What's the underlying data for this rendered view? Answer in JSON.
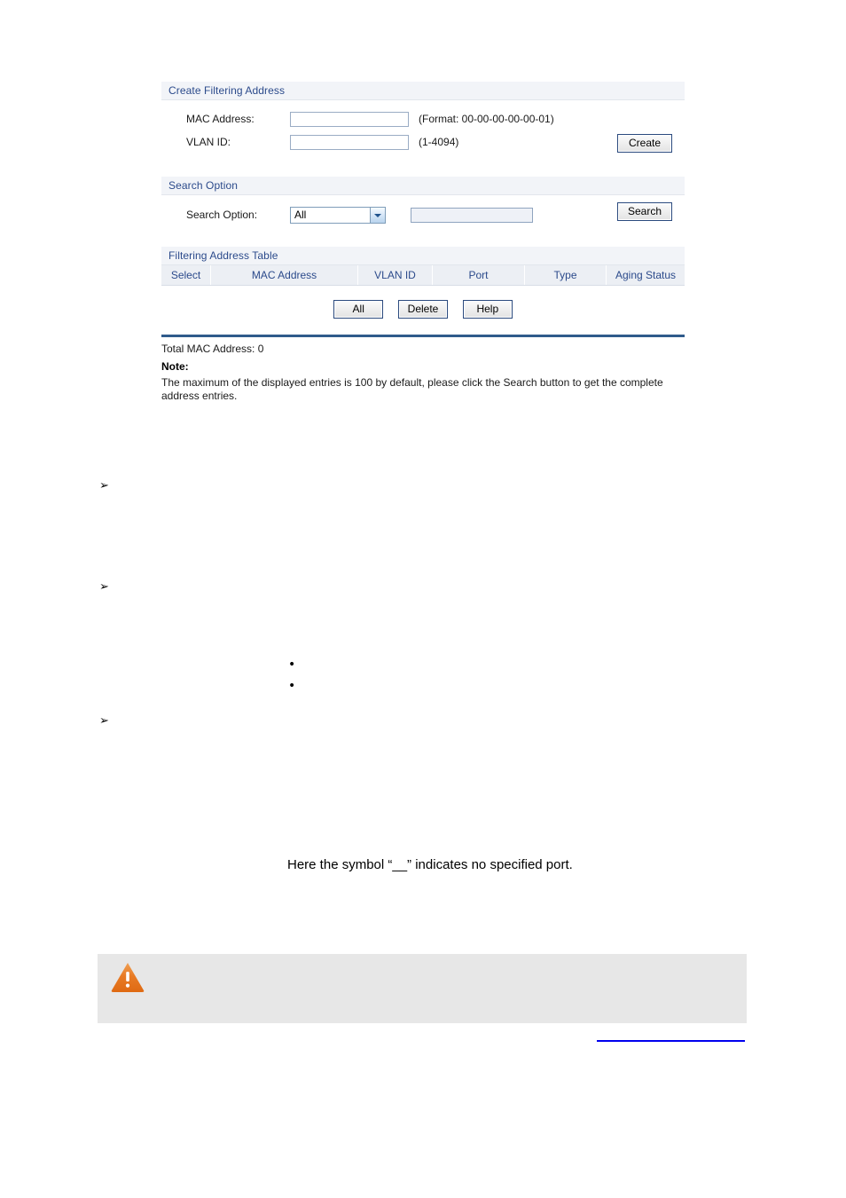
{
  "ui": {
    "create_section": {
      "title": "Create Filtering Address",
      "mac_label": "MAC Address:",
      "mac_value": "",
      "mac_hint": "(Format: 00-00-00-00-00-01)",
      "vlan_label": "VLAN ID:",
      "vlan_value": "",
      "vlan_hint": "(1-4094)",
      "create_button": "Create"
    },
    "search_section": {
      "title": "Search Option",
      "label": "Search Option:",
      "selected_option": "All",
      "options": [
        "All"
      ],
      "keyword_value": "",
      "search_button": "Search"
    },
    "table_section": {
      "title": "Filtering Address Table",
      "columns": [
        "Select",
        "MAC Address",
        "VLAN ID",
        "Port",
        "Type",
        "Aging Status"
      ],
      "rows": [],
      "buttons": [
        "All",
        "Delete",
        "Help"
      ]
    },
    "footer": {
      "total": "Total MAC Address: 0",
      "note_title": "Note:",
      "note_body": "The maximum of the displayed entries is 100 by default, please click the Search button to get the complete address entries."
    }
  },
  "document": {
    "arrow_marker": "➢",
    "bullet_marker": "•",
    "arrow_items": [
      "",
      "",
      ""
    ],
    "bullet_items": [
      "",
      ""
    ],
    "sentence": "Here the symbol “__” indicates no specified port.",
    "callout_text": "",
    "bottom_link_text": ""
  },
  "colors": {
    "accent_blue": "#2b4a8b",
    "rule_blue": "#2f5b8b",
    "warning_orange": "#e8761e",
    "link_blue": "#0000ee",
    "panel_head_bg": "#f2f4f8"
  }
}
